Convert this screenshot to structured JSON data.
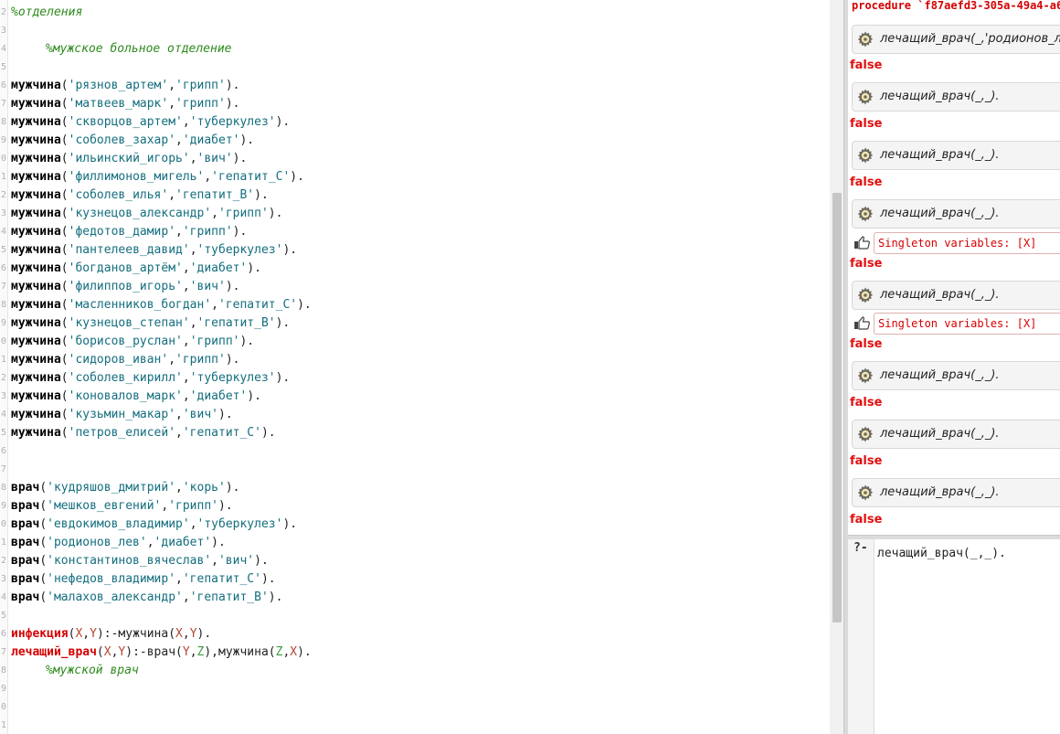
{
  "editor": {
    "line_numbers": [
      "2",
      "3",
      "4",
      "5",
      "6",
      "7",
      "8",
      "9",
      "0",
      "1",
      "2",
      "3",
      "4",
      "5",
      "6",
      "7",
      "8",
      "9",
      "0",
      "1",
      "2",
      "3",
      "4",
      "5",
      "6",
      "7",
      "8",
      "9",
      "0",
      "1",
      "2",
      "3",
      "4",
      "5",
      "6",
      "7",
      "8",
      "9",
      "0",
      "1"
    ],
    "comment_departments": "%отделения",
    "comment_male_ward": "%мужское больное отделение",
    "patient_predicate": "мужчина",
    "patients": [
      {
        "name": "'рязнов_артем'",
        "disease": "'грипп'"
      },
      {
        "name": "'матвеев_марк'",
        "disease": "'грипп'"
      },
      {
        "name": "'скворцов_артем'",
        "disease": "'туберкулез'"
      },
      {
        "name": "'соболев_захар'",
        "disease": "'диабет'"
      },
      {
        "name": "'ильинский_игорь'",
        "disease": "'вич'"
      },
      {
        "name": "'филлимонов_мигель'",
        "disease": "'гепатит_С'"
      },
      {
        "name": "'соболев_илья'",
        "disease": "'гепатит_В'"
      },
      {
        "name": "'кузнецов_александр'",
        "disease": "'грипп'"
      },
      {
        "name": "'федотов_дамир'",
        "disease": "'грипп'"
      },
      {
        "name": "'пантелеев_давид'",
        "disease": "'туберкулез'"
      },
      {
        "name": "'богданов_артём'",
        "disease": "'диабет'"
      },
      {
        "name": "'филиппов_игорь'",
        "disease": "'вич'"
      },
      {
        "name": "'масленников_богдан'",
        "disease": "'гепатит_С'"
      },
      {
        "name": "'кузнецов_степан'",
        "disease": "'гепатит_В'"
      },
      {
        "name": "'борисов_руслан'",
        "disease": "'грипп'"
      },
      {
        "name": "'сидоров_иван'",
        "disease": "'грипп'"
      },
      {
        "name": "'соболев_кирилл'",
        "disease": "'туберкулез'"
      },
      {
        "name": "'коновалов_марк'",
        "disease": "'диабет'"
      },
      {
        "name": "'кузьмин_макар'",
        "disease": "'вич'"
      },
      {
        "name": "'петров_елисей'",
        "disease": "'гепатит_С'"
      }
    ],
    "doctor_predicate": "врач",
    "doctors": [
      {
        "name": "'кудряшов_дмитрий'",
        "disease": "'корь'"
      },
      {
        "name": "'мешков_евгений'",
        "disease": "'грипп'"
      },
      {
        "name": "'евдокимов_владимир'",
        "disease": "'туберкулез'"
      },
      {
        "name": "'родионов_лев'",
        "disease": "'диабет'"
      },
      {
        "name": "'константинов_вячеслав'",
        "disease": "'вич'"
      },
      {
        "name": "'нефедов_владимир'",
        "disease": "'гепатит_С'"
      },
      {
        "name": "'малахов_александр'",
        "disease": "'гепатит_В'"
      }
    ],
    "rule1": {
      "head": "инфекция",
      "args": [
        "X",
        "Y"
      ],
      "neck": ":-",
      "body_pred": "мужчина",
      "body_args": [
        "X",
        "Y"
      ]
    },
    "rule2": {
      "head": "лечащий_врач",
      "args": [
        "X",
        "Y"
      ],
      "neck": ":-",
      "b1": "врач",
      "b1_args": [
        "Y",
        "Z"
      ],
      "b2": "мужчина",
      "b2_args": [
        "Z",
        "X"
      ]
    },
    "comment_male_doctor": "%мужской врач"
  },
  "results": {
    "procedure_text": "procedure `f87aefd3-305a-49a4-a6",
    "first_query": "лечащий_врач(_,'родионов_лев')",
    "repeat_query": "лечащий_врач(_,_).",
    "false_label": "false",
    "singleton_warning": "Singleton variables: [X]"
  },
  "query_input": {
    "prompt": "?-",
    "value": "лечащий_врач(_,_)."
  },
  "colors": {
    "comment": "#2e8b1e",
    "atom": "#146e7e",
    "rule_head": "#d40000",
    "false": "#e01010",
    "warning": "#d40000"
  },
  "icons": [
    "gear-icon",
    "pointing-hand-icon"
  ]
}
